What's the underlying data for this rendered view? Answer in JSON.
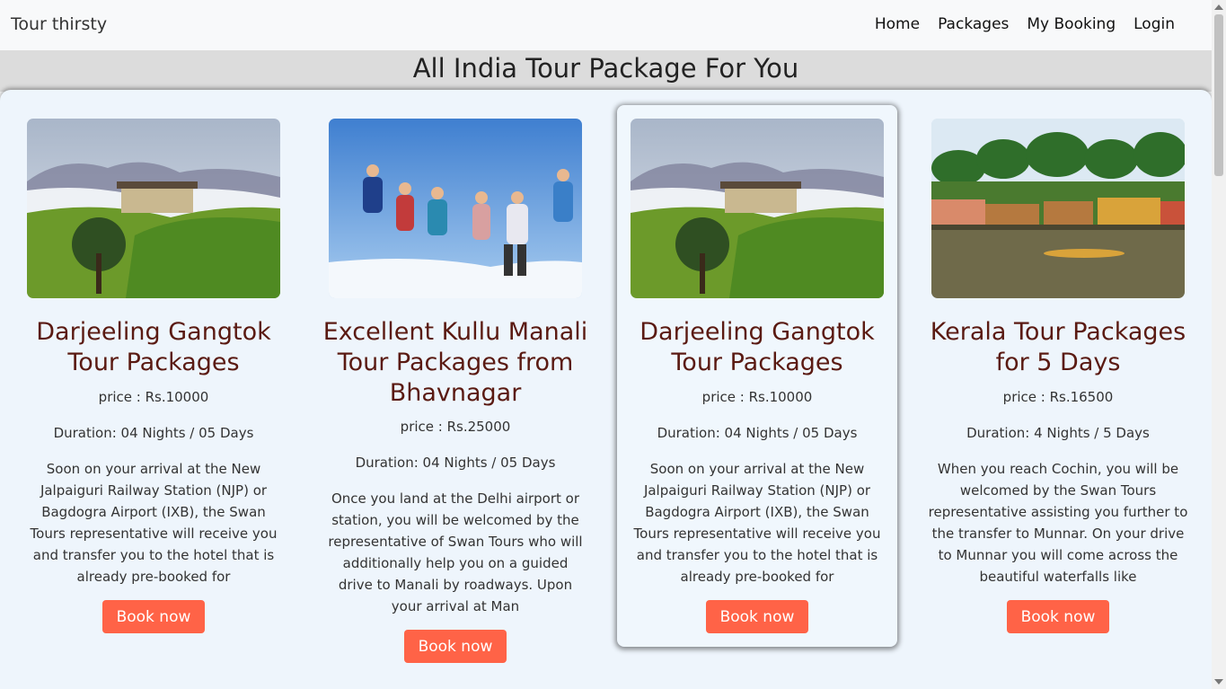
{
  "navbar": {
    "brand": "Tour thirsty",
    "links": [
      "Home",
      "Packages",
      "My Booking",
      "Login"
    ]
  },
  "page": {
    "heading": "All India Tour Package For You"
  },
  "cards": [
    {
      "title": "Darjeeling Gangtok Tour Packages",
      "price": "price : Rs.10000",
      "duration": "Duration: 04 Nights / 05 Days",
      "description": "Soon on your arrival at the New Jalpaiguri Railway Station (NJP) or Bagdogra Airport (IXB), the Swan Tours representative will receive you and transfer you to the hotel that is already pre-booked for",
      "button": "Book now",
      "image": "tea-estate-hills"
    },
    {
      "title": "Excellent Kullu Manali Tour Packages from Bhavnagar",
      "price": "price : Rs.25000",
      "duration": "Duration: 04 Nights / 05 Days",
      "description": "Once you land at the Delhi airport or station, you will be welcomed by the representative of Swan Tours who will additionally help you on a guided drive to Manali by roadways. Upon your arrival at Man",
      "button": "Book now",
      "image": "people-jumping-snow"
    },
    {
      "title": "Darjeeling Gangtok Tour Packages",
      "price": "price : Rs.10000",
      "duration": "Duration: 04 Nights / 05 Days",
      "description": "Soon on your arrival at the New Jalpaiguri Railway Station (NJP) or Bagdogra Airport (IXB), the Swan Tours representative will receive you and transfer you to the hotel that is already pre-booked for",
      "button": "Book now",
      "image": "tea-estate-hills"
    },
    {
      "title": "Kerala Tour Packages for 5 Days",
      "price": "price : Rs.16500",
      "duration": "Duration: 4 Nights / 5 Days",
      "description": "When you reach Cochin, you will be welcomed by the Swan Tours representative assisting you further to the transfer to Munnar. On your drive to Munnar you will come across the beautiful waterfalls like",
      "button": "Book now",
      "image": "kerala-backwaters-houseboats"
    }
  ]
}
